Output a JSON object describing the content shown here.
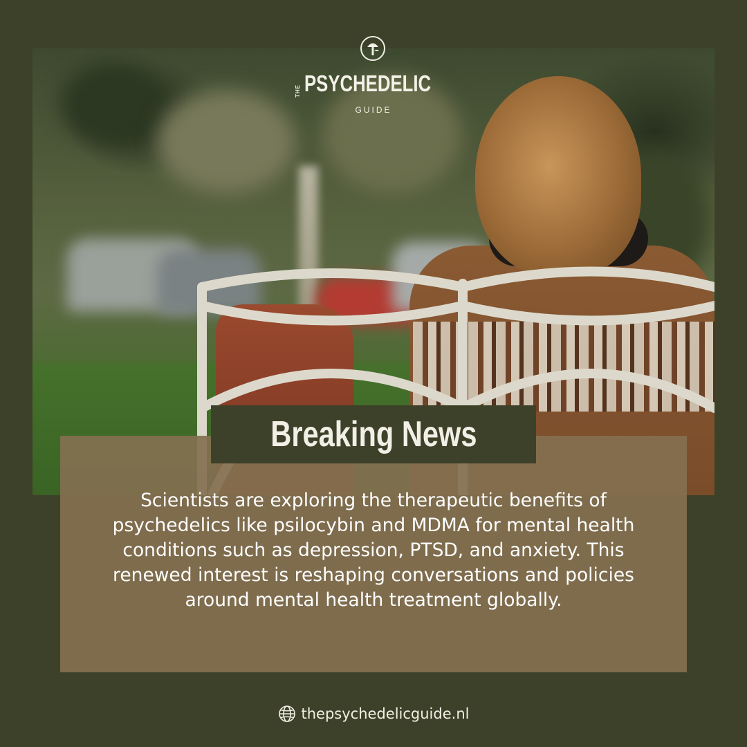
{
  "logo": {
    "the": "THE",
    "wordmark": "PSYCHEDELIC",
    "sub": "GUIDE",
    "icon": "mushroom-logo-icon"
  },
  "badge": {
    "label": "Breaking News"
  },
  "body": {
    "text": "Scientists are exploring the therapeutic benefits of psychedelics like psilocybin and MDMA for mental health conditions such as depression, PTSD, and anxiety. This renewed interest is reshaping conversations and policies around mental health treatment globally."
  },
  "footer": {
    "icon": "globe-icon",
    "url": "thepsychedelicguide.nl"
  },
  "colors": {
    "background": "#3d4129",
    "card": "#837050",
    "badge": "#3e4129",
    "text": "#ffffff"
  }
}
